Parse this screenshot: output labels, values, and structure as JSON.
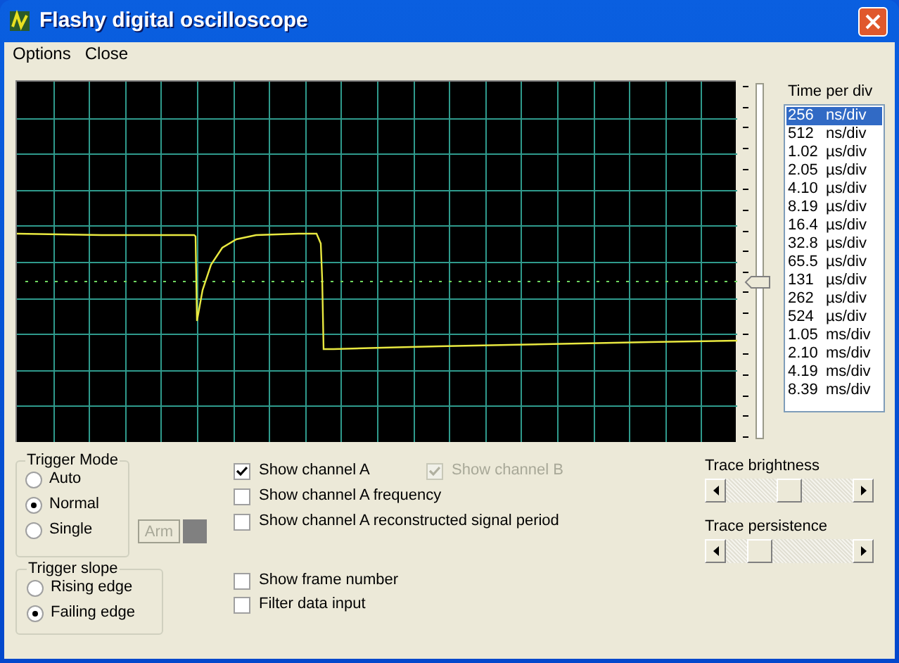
{
  "window": {
    "title": "Flashy digital oscilloscope"
  },
  "menu": [
    {
      "label": "Options"
    },
    {
      "label": "Close"
    }
  ],
  "trigger_level_slider": {
    "level": 0.44
  },
  "time_per_div": {
    "label": "Time per div",
    "items": [
      {
        "value": "256",
        "unit": "ns/div",
        "selected": true
      },
      {
        "value": "512",
        "unit": "ns/div",
        "selected": false
      },
      {
        "value": "1.02",
        "unit": "µs/div",
        "selected": false
      },
      {
        "value": "2.05",
        "unit": "µs/div",
        "selected": false
      },
      {
        "value": "4.10",
        "unit": "µs/div",
        "selected": false
      },
      {
        "value": "8.19",
        "unit": "µs/div",
        "selected": false
      },
      {
        "value": "16.4",
        "unit": "µs/div",
        "selected": false
      },
      {
        "value": "32.8",
        "unit": "µs/div",
        "selected": false
      },
      {
        "value": "65.5",
        "unit": "µs/div",
        "selected": false
      },
      {
        "value": "131",
        "unit": "µs/div",
        "selected": false
      },
      {
        "value": "262",
        "unit": "µs/div",
        "selected": false
      },
      {
        "value": "524",
        "unit": "µs/div",
        "selected": false
      },
      {
        "value": "1.05",
        "unit": "ms/div",
        "selected": false
      },
      {
        "value": "2.10",
        "unit": "ms/div",
        "selected": false
      },
      {
        "value": "4.19",
        "unit": "ms/div",
        "selected": false
      },
      {
        "value": "8.39",
        "unit": "ms/div",
        "selected": false
      }
    ]
  },
  "trigger_mode": {
    "title": "Trigger Mode",
    "options": [
      {
        "label": "Auto",
        "selected": false
      },
      {
        "label": "Normal",
        "selected": true
      },
      {
        "label": "Single",
        "selected": false
      }
    ]
  },
  "arm_button": {
    "label": "Arm",
    "disabled": true
  },
  "trigger_slope": {
    "title": "Trigger slope",
    "options": [
      {
        "label": "Rising edge",
        "selected": false
      },
      {
        "label": "Failing edge",
        "selected": true
      }
    ]
  },
  "checkbox_rows": [
    [
      {
        "label": "Show channel A",
        "checked": true,
        "disabled": false
      },
      {
        "label": "Show channel B",
        "checked": true,
        "disabled": true
      }
    ],
    [
      {
        "label": "Show channel A frequency",
        "checked": false,
        "disabled": false
      }
    ],
    [
      {
        "label": "Show channel A reconstructed signal period",
        "checked": false,
        "disabled": false
      }
    ]
  ],
  "checkbox_rows_lower": [
    [
      {
        "label": "Show frame number",
        "checked": false,
        "disabled": false
      }
    ],
    [
      {
        "label": "Filter data input",
        "checked": false,
        "disabled": false
      }
    ]
  ],
  "trace_brightness": {
    "label": "Trace brightness",
    "level": 0.5
  },
  "trace_persistence": {
    "label": "Trace persistence",
    "level": 0.21
  }
}
